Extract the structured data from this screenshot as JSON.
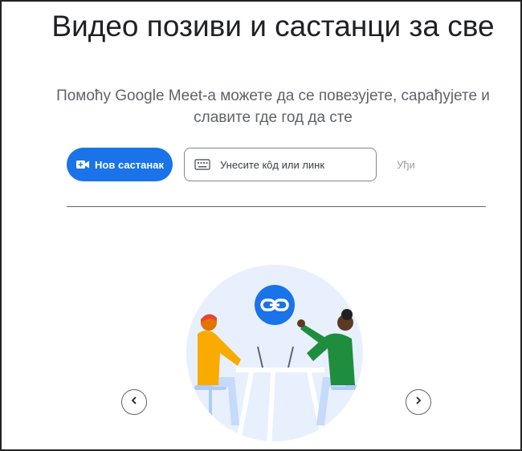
{
  "hero": {
    "title": "Видео позиви и састанци за све",
    "subtitle": "Помоћу Google Meet-а можете да се повезујете, сарађујете и славите где год да сте"
  },
  "actions": {
    "new_meeting_label": "Нов састанак",
    "code_placeholder": "Унесите кôд или линк",
    "join_label": "Уђи"
  },
  "icons": {
    "new_meeting": "video-camera-plus-icon",
    "code_input": "keyboard-icon",
    "carousel_prev": "chevron-left-icon",
    "carousel_next": "chevron-right-icon",
    "illustration_badge": "link-icon"
  },
  "colors": {
    "accent": "#1a73e8",
    "title": "#202124",
    "muted": "#5f6368",
    "disabled": "#9aa0a6",
    "illustration_bg": "#e8f0fe"
  }
}
